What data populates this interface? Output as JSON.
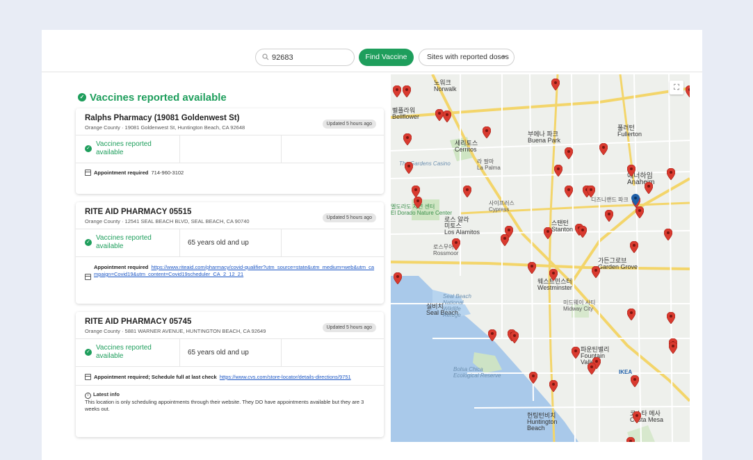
{
  "search": {
    "value": "92683"
  },
  "find_button": "Find Vaccine",
  "filter": {
    "label": "Sites with reported doses"
  },
  "heading": "Vaccines reported available",
  "cards": [
    {
      "title": "Ralphs Pharmacy (19081 Goldenwest St)",
      "county": "Orange County",
      "address": "19081 Goldenwest St, Huntington Beach, CA 92648",
      "updated": "Updated 5 hours ago",
      "status": "Vaccines reported available",
      "eligibility": "",
      "appointment": "Appointment required",
      "appointment_detail": "714-960-3102"
    },
    {
      "title": "RITE AID PHARMACY 05515",
      "county": "Orange County",
      "address": "12541 SEAL BEACH BLVD, SEAL BEACH, CA 90740",
      "updated": "Updated 5 hours ago",
      "status": "Vaccines reported available",
      "eligibility": "65 years old and up",
      "appointment": "Appointment required",
      "appointment_link": "https://www.riteaid.com/pharmacy/covid-qualifier?utm_source=state&utm_medium=web&utm_campaign=Covid19&utm_content=Covid19scheduler_CA_2_12_21"
    },
    {
      "title": "RITE AID PHARMACY 05745",
      "county": "Orange County",
      "address": "5881 WARNER AVENUE, HUNTINGTON BEACH, CA 92649",
      "updated": "Updated 5 hours ago",
      "status": "Vaccines reported available",
      "eligibility": "65 years old and up",
      "appointment": "Appointment required; Schedule full at last check",
      "appointment_link": "https://www.cvs.com/store-locator/details-directions/9751",
      "info_title": "Latest info",
      "info_text": "This location is only scheduling appointments through their website. They DO have appointments available but they are 3 weeks out."
    }
  ],
  "map": {
    "labels": {
      "norwalk": "노워크\nNorwalk",
      "bellflower": "벨플라워\nBellflower",
      "buena_park": "부에나 파크\nBuena Park",
      "fullerton": "풀러턴\nFullerton",
      "cerritos": "세리토스\nCerritos",
      "la_palma": "라 팔마\nLa Palma",
      "anaheim": "애너하임\nAnaheim",
      "cypress": "사이프러스\nCypress",
      "los_alamitos": "로스 알라\n미토스\nLos Alamitos",
      "stanton": "스탠턴\nStanton",
      "rossmoor": "로스무어\nRossmoor",
      "garden_grove": "가든그로브\nGarden Grove",
      "westminster": "웨스트민스터\nWestminster",
      "seal_beach": "실비치\nSeal Beach",
      "seal_beach_refuge": "Seal Beach\nNational\nWildlife\nRefuge",
      "midway_city": "미드웨이 시티\nMidway City",
      "fountain_valley": "파운틴밸리\nFountain\nValley",
      "bolsa_chica": "Bolsa Chica\nEcological Reserve",
      "huntington_beach": "헌팅턴비치\nHuntington\nBeach",
      "costa_mesa": "코스타 메사\nCosta Mesa",
      "gardens_casino": "The Gardens Casino",
      "el_dorado": "엘도라도 자연 센터\nEl Dorado Nature Center",
      "ikea": "IKEA",
      "disneyland": "디즈니랜드 파크"
    },
    "pin_color": "#d93a2f",
    "selected_pin_color": "#1f5fa8"
  }
}
